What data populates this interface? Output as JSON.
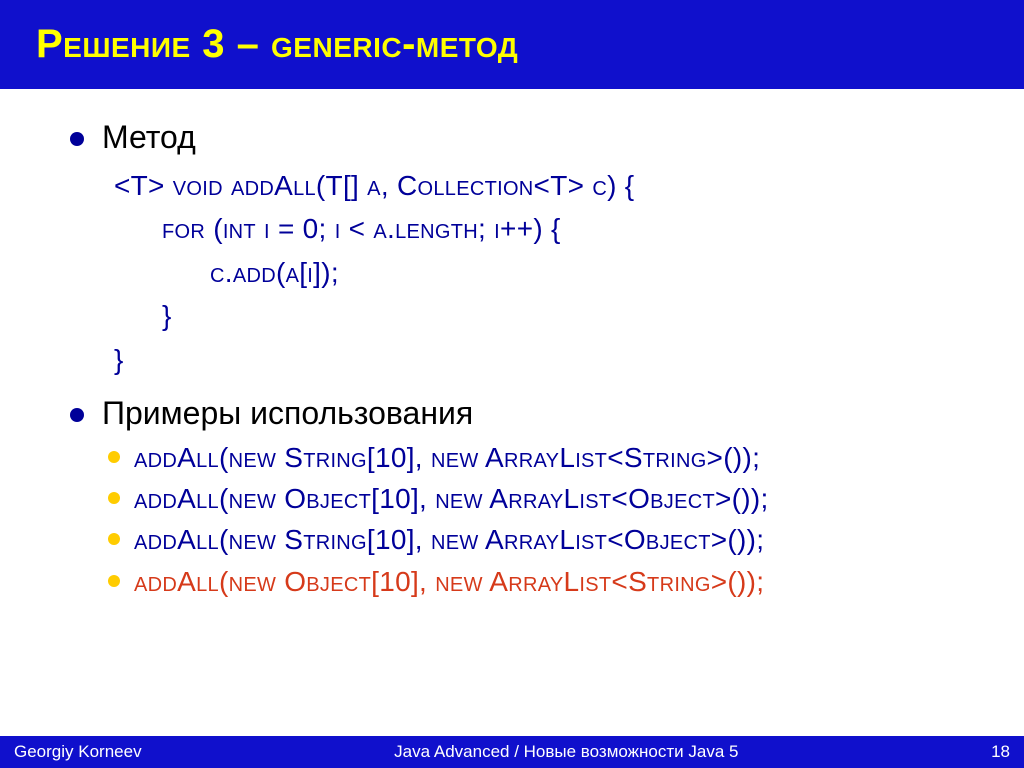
{
  "title": "Решение 3 – generic-метод",
  "section1": "Метод",
  "code": {
    "l1": "<T> void addAll(T[] a, Collection<T> c) {",
    "l2": "for (int i = 0; i < a.length; i++) {",
    "l3": "c.add(a[i]);",
    "l4": "}",
    "l5": "}"
  },
  "section2": "Примеры использования",
  "examples": {
    "e1": "addAll(new String[10], new ArrayList<String>());",
    "e2": "addAll(new Object[10], new ArrayList<Object>());",
    "e3": "addAll(new String[10], new ArrayList<Object>());",
    "e4": "addAll(new Object[10], new ArrayList<String>());"
  },
  "footer": {
    "author": "Georgiy Korneev",
    "course": "Java Advanced / Новые возможности Java 5",
    "page": "18"
  }
}
